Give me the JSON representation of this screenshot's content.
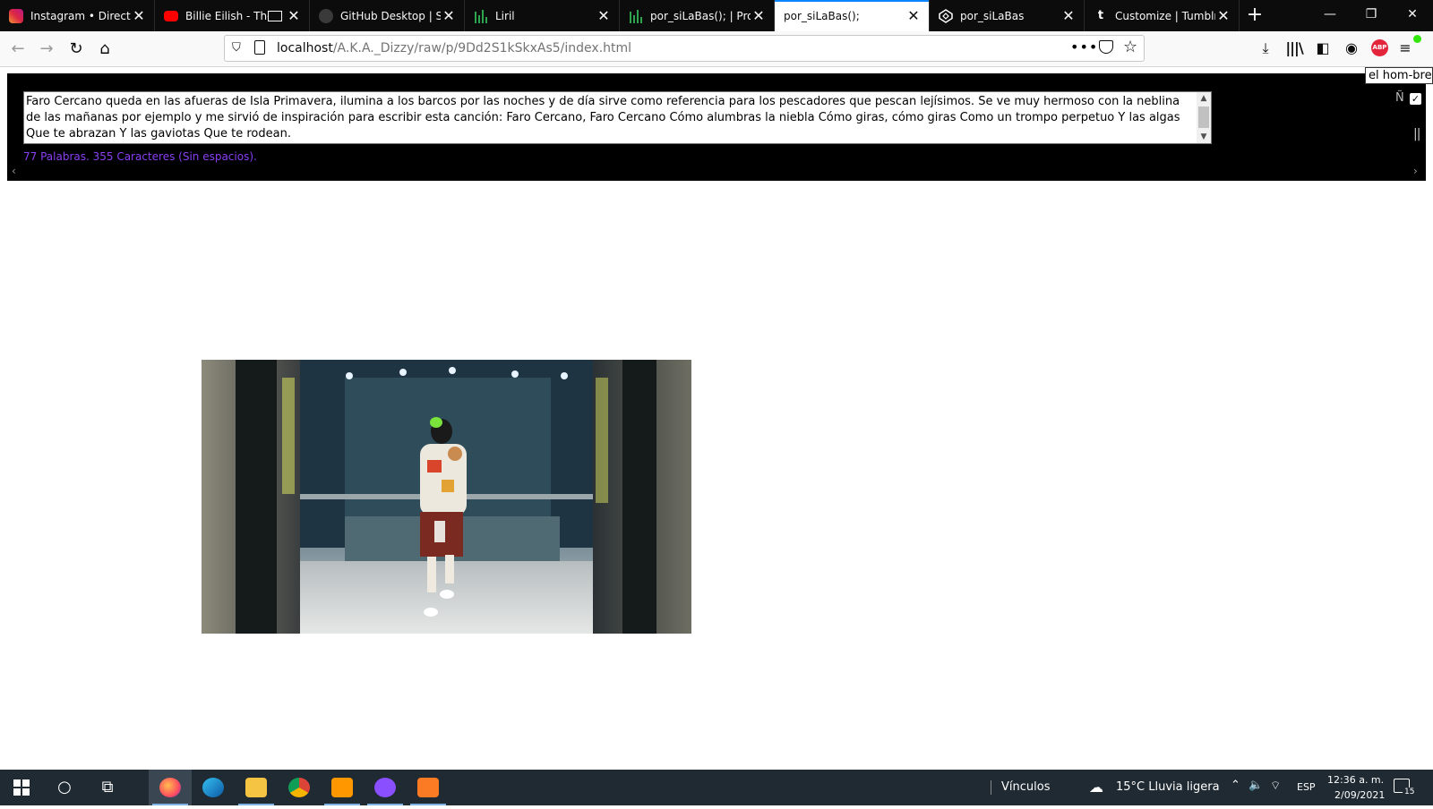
{
  "browser": {
    "tabs": [
      {
        "title": "Instagram • Direct",
        "favicon_color": "#d6249f"
      },
      {
        "title": "Billie Eilish - There",
        "favicon_color": "#ff0000"
      },
      {
        "title": "GitHub Desktop | Sim",
        "favicon_color": "#24292e"
      },
      {
        "title": "Liril",
        "favicon_color": "#2ea44f"
      },
      {
        "title": "por_siLaBas(); | Proye",
        "favicon_color": "#2ea44f"
      },
      {
        "title": "por_siLaBas();",
        "favicon_color": ""
      },
      {
        "title": "por_siLaBas",
        "favicon_color": "#ffffff"
      },
      {
        "title": "Customize | Tumblr",
        "favicon_color": "#ffffff"
      }
    ],
    "active_tab_index": 5,
    "url_host": "localhost",
    "url_path": "/A.K.A._Dizzy/raw/p/9Dd2S1kSkxAs5/index.html"
  },
  "editor": {
    "text": "Faro Cercano queda en las afueras de Isla Primavera, ilumina a los barcos por las noches y de día sirve como referencia para los pescadores que pescan lejísimos. Se ve muy hermoso con la neblina de las mañanas por ejemplo y me sirvió de inspiración para escribir esta canción: Faro Cercano, Faro Cercano Cómo alumbras la niebla Cómo giras, cómo giras Como un trompo perpetuo Y las algas Que te abrazan Y las gaviotas Que te rodean.",
    "stats": "77 Palabras. 355 Caracteres (Sin espacios).",
    "enye_label": "Ñ",
    "tooltip": "el hom-bre."
  },
  "taskbar": {
    "links_label": "Vínculos",
    "weather": "15°C  Lluvia ligera",
    "language": "ESP",
    "time": "12:36 a. m.",
    "date": "2/09/2021",
    "notifications": "15"
  }
}
